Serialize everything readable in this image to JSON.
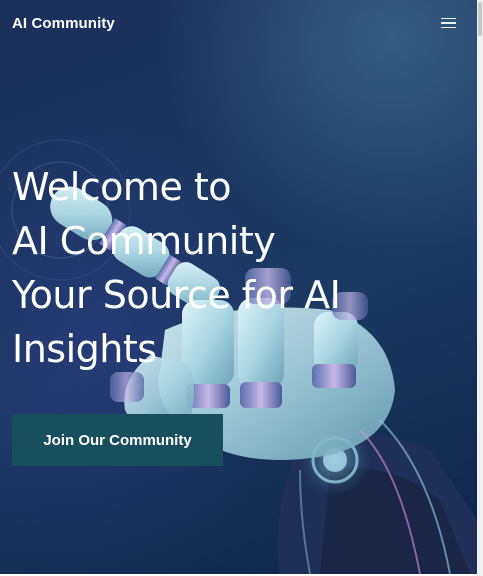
{
  "navbar": {
    "brand": "AI Community",
    "menu_icon": "hamburger-menu-icon"
  },
  "hero": {
    "title_lines": [
      "Welcome to",
      "AI Community",
      "Your Source for AI",
      "Insights"
    ],
    "cta_label": "Join Our Community"
  },
  "colors": {
    "background": "#1a3760",
    "cta": "#17505c",
    "text": "#ffffff"
  },
  "decorative_image": "robot-hand-pointing"
}
